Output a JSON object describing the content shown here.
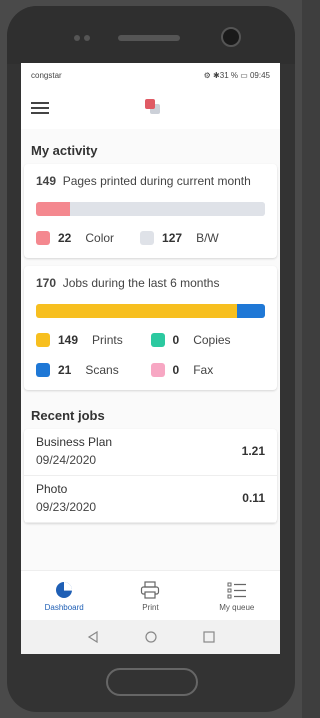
{
  "statusbar": {
    "carrier": "congstar",
    "right": "⚙ ✱31 % ▭ 09:45"
  },
  "activity": {
    "title": "My activity",
    "pages_card": {
      "count": "149",
      "text": "Pages printed during current month",
      "color_value": "22",
      "color_label": "Color",
      "bw_value": "127",
      "bw_label": "B/W",
      "color_fraction": 0.148
    },
    "jobs_card": {
      "count": "170",
      "text": "Jobs during the last 6 months",
      "prints_value": "149",
      "prints_label": "Prints",
      "copies_value": "0",
      "copies_label": "Copies",
      "scans_value": "21",
      "scans_label": "Scans",
      "fax_value": "0",
      "fax_label": "Fax",
      "prints_fraction": 0.876
    }
  },
  "recent": {
    "title": "Recent jobs",
    "items": [
      {
        "name": "Business Plan",
        "date": "09/24/2020",
        "value": "1.21"
      },
      {
        "name": "Photo",
        "date": "09/23/2020",
        "value": "0.11"
      }
    ]
  },
  "nav": {
    "dashboard": "Dashboard",
    "print": "Print",
    "queue": "My queue"
  },
  "colors": {
    "color": "#f4888f",
    "bw": "#dfe2e8",
    "prints": "#f7bf1f",
    "copies": "#2cc9a0",
    "scans": "#1f78d6",
    "fax": "#f7a7c3",
    "accent": "#1f5fb5"
  }
}
